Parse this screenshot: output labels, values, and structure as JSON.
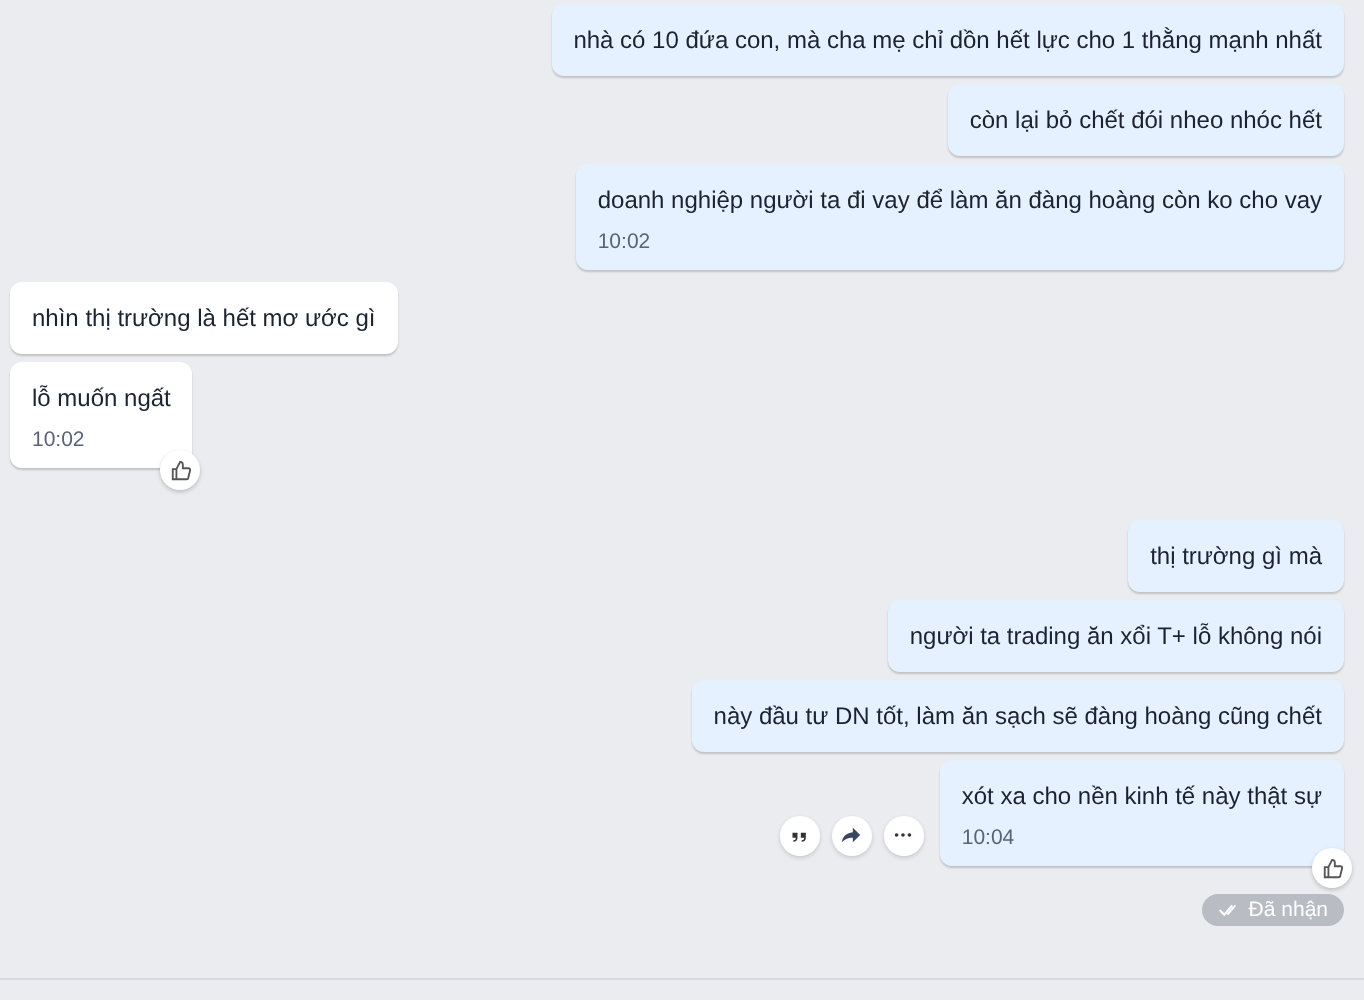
{
  "groups": [
    {
      "outgoing": true,
      "messages": [
        {
          "text": "nhà có 10 đứa con, mà cha mẹ chỉ dồn hết lực cho 1 thằng mạnh nhất",
          "liked": false
        },
        {
          "text": "còn lại bỏ chết đói nheo nhóc hết",
          "liked": false
        },
        {
          "text": "doanh nghiệp người ta đi vay để làm ăn đàng hoàng còn ko cho vay",
          "time": "10:02",
          "liked": false
        }
      ]
    },
    {
      "outgoing": false,
      "messages": [
        {
          "text": "nhìn thị trường là hết mơ ước gì",
          "liked": false
        },
        {
          "text": "lỗ muốn ngất",
          "time": "10:02",
          "liked": true
        }
      ]
    },
    {
      "outgoing": true,
      "messages": [
        {
          "text": "thị trường gì mà",
          "liked": false
        },
        {
          "text": "người ta trading ăn xổi T+ lỗ không nói",
          "liked": false
        },
        {
          "text": "này đầu tư DN tốt, làm ăn sạch sẽ đàng hoàng cũng chết",
          "liked": false
        },
        {
          "text": "xót xa cho nền kinh tế này thật sự",
          "time": "10:04",
          "liked": true,
          "actions": true
        }
      ]
    }
  ],
  "status": {
    "text": "Đã nhận"
  }
}
